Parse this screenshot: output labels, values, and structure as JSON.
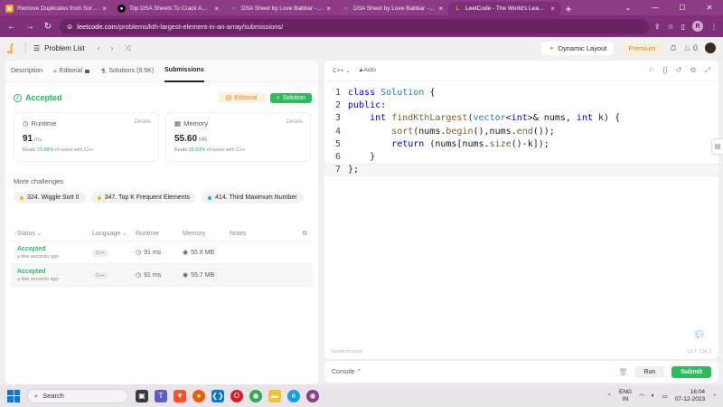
{
  "browser": {
    "tabs": [
      {
        "title": "Remove Duplicates from Sorted",
        "fav_color": "#f0a020",
        "fav_glyph": "▣",
        "active": false
      },
      {
        "title": "Top DSA Sheets To Crack Any C",
        "fav_color": "#111111",
        "fav_glyph": "●",
        "active": false
      },
      {
        "title": "DSA Sheet by Love Babbar - Gee",
        "fav_color": "#2f8d46",
        "fav_glyph": "∞",
        "active": false
      },
      {
        "title": "DSA Sheet by Love Babbar - Gee",
        "fav_color": "#2f8d46",
        "fav_glyph": "∞",
        "active": false
      },
      {
        "title": "LeetCode - The World's Leading",
        "fav_color": "#f89f1b",
        "fav_glyph": "L",
        "active": true
      }
    ],
    "new_tab": "+",
    "url_host": "leetcode.com",
    "url_path": "/problems/kth-largest-element-in-an-array/submissions/",
    "profile_initial": "R"
  },
  "header": {
    "problem_list": "Problem List",
    "dynamic_layout": "Dynamic Layout",
    "premium": "Premium",
    "streak_count": "0"
  },
  "left_tabs": {
    "description": "Description",
    "editorial": "Editorial",
    "solutions": "Solutions (9.5K)",
    "submissions": "Submissions"
  },
  "result": {
    "status": "Accepted",
    "editorial_btn": "Editorial",
    "solution_btn": "Solution"
  },
  "runtime": {
    "label": "Runtime",
    "details": "Details",
    "value": "91",
    "unit": "ms",
    "beats_prefix": "Beats",
    "beats_pct": "73.48%",
    "beats_suffix": "of users with C++"
  },
  "memory": {
    "label": "Memory",
    "details": "Details",
    "value": "55.60",
    "unit": "MB",
    "beats_prefix": "Beats",
    "beats_pct": "93.89%",
    "beats_suffix": "of users with C++"
  },
  "more_challenges": {
    "title": "More challenges",
    "items": [
      {
        "label": "324. Wiggle Sort II",
        "level": "med"
      },
      {
        "label": "347. Top K Frequent Elements",
        "level": "med"
      },
      {
        "label": "414. Third Maximum Number",
        "level": "easy"
      }
    ]
  },
  "table": {
    "headers": {
      "status": "Status",
      "language": "Language",
      "runtime": "Runtime",
      "memory": "Memory",
      "notes": "Notes"
    },
    "rows": [
      {
        "status": "Accepted",
        "time": "a few seconds ago",
        "language": "C++",
        "runtime": "91 ms",
        "memory": "55.6 MB"
      },
      {
        "status": "Accepted",
        "time": "a few seconds ago",
        "language": "C++",
        "runtime": "91 ms",
        "memory": "55.7 MB"
      }
    ]
  },
  "editor": {
    "language": "C++",
    "mode": "Auto",
    "saved": "Saved to local",
    "cursor": "Ln 7, Col 3",
    "lines": [
      "1",
      "2",
      "3",
      "4",
      "5",
      "6",
      "7"
    ]
  },
  "console": {
    "label": "Console",
    "run": "Run",
    "submit": "Submit"
  },
  "taskbar": {
    "search": "Search",
    "lang_top": "ENG",
    "lang_bottom": "IN",
    "time": "16:04",
    "date": "07-12-2023"
  }
}
